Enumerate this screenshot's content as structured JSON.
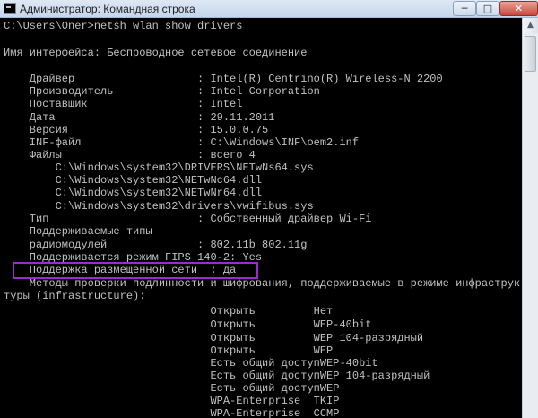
{
  "window": {
    "title": "Администратор: Командная строка",
    "minimize_glyph": "─",
    "maximize_glyph": "□",
    "close_glyph": "✕"
  },
  "console": {
    "lines": [
      "C:\\Users\\Oner>netsh wlan show drivers",
      "",
      "Имя интерфейса: Беспроводное сетевое соединение",
      "",
      "    Драйвер                   : Intel(R) Centrino(R) Wireless-N 2200",
      "    Производитель             : Intel Corporation",
      "    Поставщик                 : Intel",
      "    Дата                      : 29.11.2011",
      "    Версия                    : 15.0.0.75",
      "    INF-файл                  : C:\\Windows\\INF\\oem2.inf",
      "    Файлы                     : всего 4",
      "        C:\\Windows\\system32\\DRIVERS\\NETwNs64.sys",
      "        C:\\Windows\\system32\\NETwNc64.dll",
      "        C:\\Windows\\system32\\NETwNr64.dll",
      "        C:\\Windows\\system32\\drivers\\vwifibus.sys",
      "    Тип                       : Собственный драйвер Wi-Fi",
      "    Поддерживаемые типы",
      "    радиомодулей              : 802.11b 802.11g",
      "    Поддерживается режим FIPS 140-2: Yes",
      "    Поддержка размещенной сети  : да",
      "    Методы проверки подлинности и шифрования, поддерживаемые в режиме инфраструк",
      "туры (infrastructure):",
      "                                Открыть         Нет",
      "                                Открыть         WEP-40bit",
      "                                Открыть         WEP 104-разрядный",
      "                                Открыть         WEP",
      "                                Есть общий доступWEP-40bit",
      "                                Есть общий доступWEP 104-разрядный",
      "                                Есть общий доступWEP",
      "                                WPA-Enterprise  TKIP",
      "                                WPA-Enterprise  CCMP"
    ]
  },
  "scrollbar": {
    "up_glyph": "▲"
  }
}
